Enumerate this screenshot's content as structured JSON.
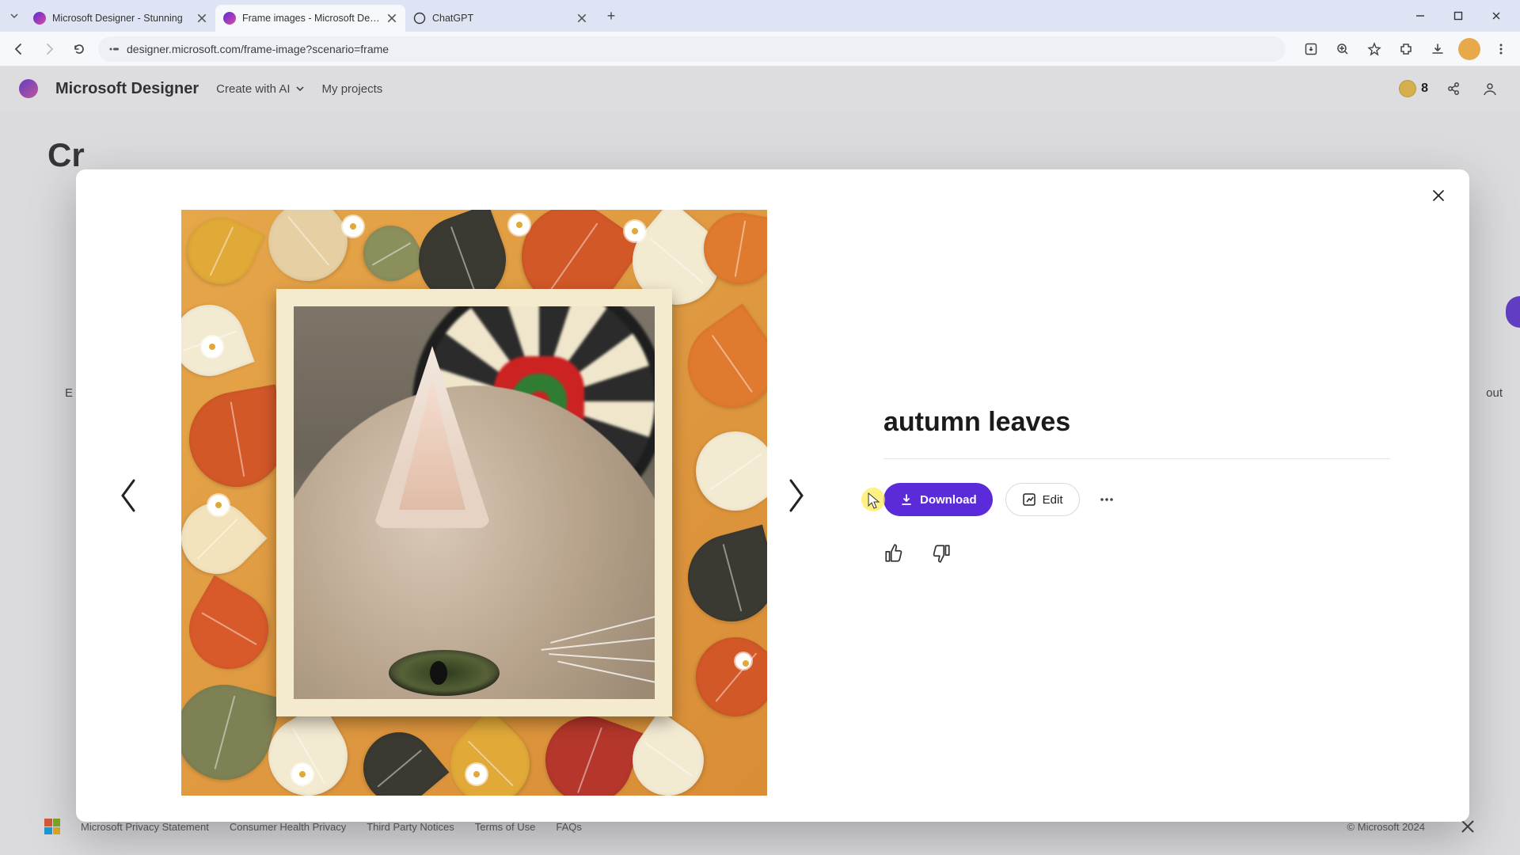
{
  "browser": {
    "tabs": [
      {
        "title": "Microsoft Designer - Stunning"
      },
      {
        "title": "Frame images - Microsoft Des…"
      },
      {
        "title": "ChatGPT"
      }
    ],
    "active_tab_index": 1,
    "url": "designer.microsoft.com/frame-image?scenario=frame"
  },
  "app_header": {
    "brand": "Microsoft Designer",
    "menu_create": "Create with AI",
    "menu_projects": "My projects",
    "coin_count": "8"
  },
  "background": {
    "heading_fragment": "Cr",
    "left_text_fragment": "E",
    "right_text_fragment": "out"
  },
  "modal": {
    "title": "autumn leaves",
    "download_label": "Download",
    "edit_label": "Edit"
  },
  "footer": {
    "links": [
      "Microsoft Privacy Statement",
      "Consumer Health Privacy",
      "Third Party Notices",
      "Terms of Use",
      "FAQs"
    ],
    "copyright": "© Microsoft 2024"
  }
}
